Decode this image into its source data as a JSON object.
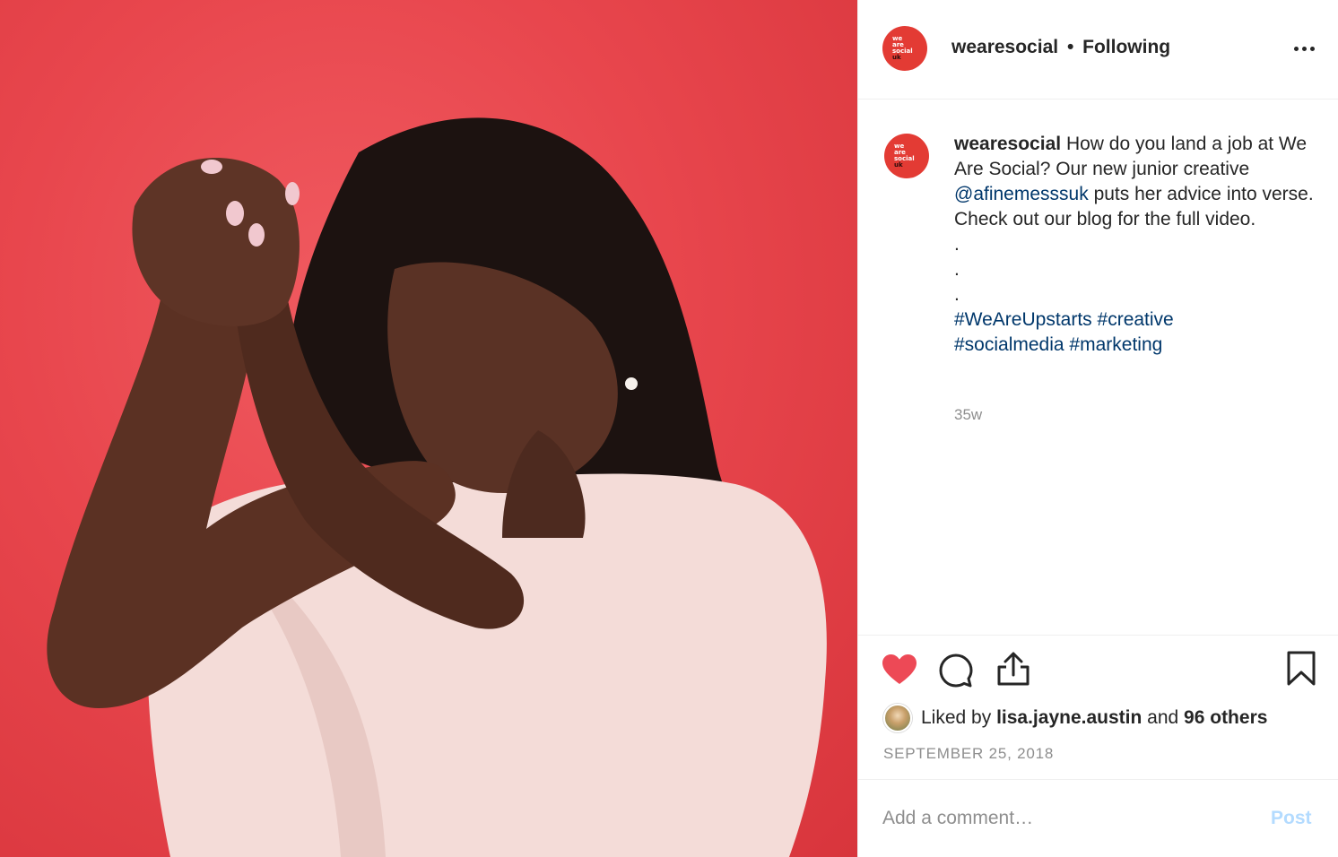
{
  "post": {
    "username": "wearesocial",
    "follow_separator": "•",
    "follow_status": "Following",
    "avatar_text": [
      "we",
      "are",
      "social",
      "uk"
    ],
    "brand_color": "#e33b34"
  },
  "caption": {
    "username": "wearesocial",
    "text_1": "How do you land a job at We Are Social? Our new junior creative",
    "mention": "@afinemesssuk",
    "text_2": "puts her advice into verse. Check out our blog for the full video.",
    "dots": [
      ".",
      ".",
      "."
    ],
    "hashtags": [
      "#WeAreUpstarts",
      "#creative",
      "#socialmedia",
      "#marketing"
    ],
    "time_ago": "35w"
  },
  "actions": {
    "icons": [
      "heart-icon",
      "comment-icon",
      "share-icon",
      "bookmark-icon"
    ],
    "heart_color": "#ed4956",
    "liked_prefix": "Liked by",
    "liked_user": "lisa.jayne.austin",
    "liked_and": "and",
    "liked_others": "96 others",
    "date": "SEPTEMBER 25, 2018"
  },
  "comment": {
    "placeholder": "Add a comment…",
    "post_label": "Post"
  }
}
